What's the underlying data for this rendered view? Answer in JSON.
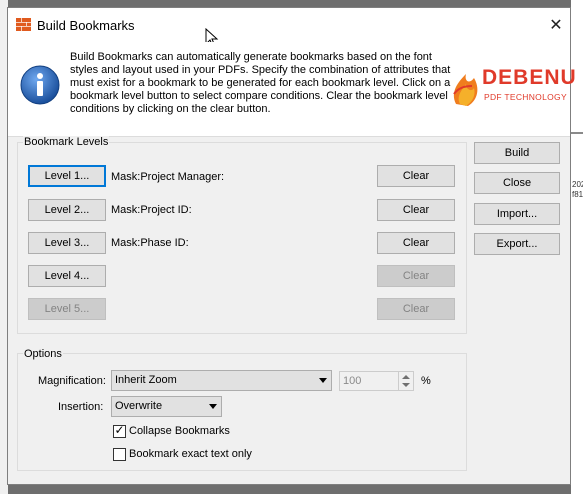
{
  "window": {
    "title": "Build Bookmarks",
    "close_glyph": "✕"
  },
  "info": {
    "description": "Build Bookmarks can automatically generate bookmarks based on the font styles and layout used in your PDFs. Specify the combination of attributes that must exist for a bookmark to be generated for each bookmark level. Click on a bookmark level button to select compare conditions. Clear the bookmark level conditions by clicking on the clear button.",
    "logo_word": "DEBENU",
    "logo_sub": "PDF TECHNOLOGY",
    "icon": "info-icon"
  },
  "bookmark_levels": {
    "group_label": "Bookmark Levels",
    "levels": [
      {
        "button": "Level 1...",
        "condition": "Mask:Project Manager:",
        "clear": "Clear",
        "enabled": true,
        "clear_enabled": true
      },
      {
        "button": "Level 2...",
        "condition": "Mask:Project ID:",
        "clear": "Clear",
        "enabled": true,
        "clear_enabled": true
      },
      {
        "button": "Level 3...",
        "condition": "Mask:Phase ID:",
        "clear": "Clear",
        "enabled": true,
        "clear_enabled": true
      },
      {
        "button": "Level 4...",
        "condition": "",
        "clear": "Clear",
        "enabled": true,
        "clear_enabled": false
      },
      {
        "button": "Level 5...",
        "condition": "",
        "clear": "Clear",
        "enabled": false,
        "clear_enabled": false
      }
    ]
  },
  "side_buttons": {
    "build": "Build",
    "close": "Close",
    "import": "Import...",
    "export": "Export..."
  },
  "options": {
    "group_label": "Options",
    "magnification_label": "Magnification:",
    "magnification_value": "Inherit Zoom",
    "zoom_value": "100",
    "zoom_unit": "%",
    "insertion_label": "Insertion:",
    "insertion_value": "Overwrite",
    "collapse_label": "Collapse Bookmarks",
    "collapse_checked": true,
    "collapse_mark": "✓",
    "exact_label": "Bookmark exact text only",
    "exact_checked": false
  },
  "background": {
    "edge_text": "202\nf81"
  },
  "colors": {
    "focus_border": "#0078d7",
    "logo_red": "#e03a2a",
    "info_blue": "#1e5fb4"
  }
}
